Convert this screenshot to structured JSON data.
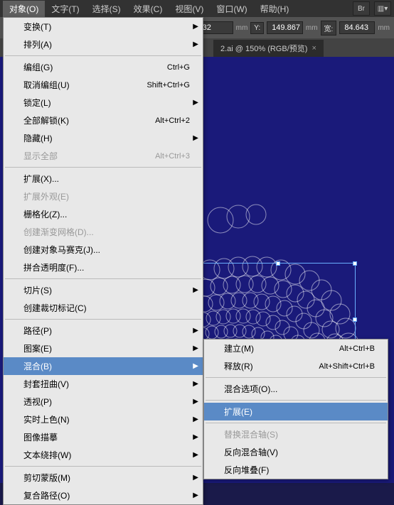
{
  "menubar": {
    "items": [
      "对象(O)",
      "文字(T)",
      "选择(S)",
      "效果(C)",
      "视图(V)",
      "窗口(W)",
      "帮助(H)"
    ],
    "active": 0,
    "right_btn1": "Br",
    "right_btn2": "▥▾"
  },
  "toolbar": {
    "x_val": "32",
    "x_unit": "mm",
    "y_label": "Y:",
    "y_val": "149.867",
    "y_unit": "mm",
    "w_label": "宽:",
    "w_val": "84.643",
    "w_unit": "mm"
  },
  "tabs": {
    "active": {
      "label": "2.ai @ 150% (RGB/预览)",
      "close": "×"
    }
  },
  "menu": [
    {
      "label": "变换(T)",
      "sub": true
    },
    {
      "label": "排列(A)",
      "sub": true
    },
    {
      "sep": true
    },
    {
      "label": "编组(G)",
      "shortcut": "Ctrl+G"
    },
    {
      "label": "取消编组(U)",
      "shortcut": "Shift+Ctrl+G"
    },
    {
      "label": "锁定(L)",
      "sub": true
    },
    {
      "label": "全部解锁(K)",
      "shortcut": "Alt+Ctrl+2"
    },
    {
      "label": "隐藏(H)",
      "sub": true
    },
    {
      "label": "显示全部",
      "shortcut": "Alt+Ctrl+3",
      "disabled": true
    },
    {
      "sep": true
    },
    {
      "label": "扩展(X)..."
    },
    {
      "label": "扩展外观(E)",
      "disabled": true
    },
    {
      "label": "栅格化(Z)..."
    },
    {
      "label": "创建渐变网格(D)...",
      "disabled": true
    },
    {
      "label": "创建对象马赛克(J)..."
    },
    {
      "label": "拼合透明度(F)..."
    },
    {
      "sep": true
    },
    {
      "label": "切片(S)",
      "sub": true
    },
    {
      "label": "创建裁切标记(C)"
    },
    {
      "sep": true
    },
    {
      "label": "路径(P)",
      "sub": true
    },
    {
      "label": "图案(E)",
      "sub": true
    },
    {
      "label": "混合(B)",
      "sub": true,
      "highlight": true
    },
    {
      "label": "封套扭曲(V)",
      "sub": true
    },
    {
      "label": "透视(P)",
      "sub": true
    },
    {
      "label": "实时上色(N)",
      "sub": true
    },
    {
      "label": "图像描摹",
      "sub": true
    },
    {
      "label": "文本绕排(W)",
      "sub": true
    },
    {
      "sep": true
    },
    {
      "label": "剪切蒙版(M)",
      "sub": true
    },
    {
      "label": "复合路径(O)",
      "sub": true
    }
  ],
  "submenu": [
    {
      "label": "建立(M)",
      "shortcut": "Alt+Ctrl+B"
    },
    {
      "label": "释放(R)",
      "shortcut": "Alt+Shift+Ctrl+B"
    },
    {
      "sep": true
    },
    {
      "label": "混合选项(O)..."
    },
    {
      "sep": true
    },
    {
      "label": "扩展(E)",
      "highlight": true
    },
    {
      "sep": true
    },
    {
      "label": "替换混合轴(S)",
      "disabled": true
    },
    {
      "label": "反向混合轴(V)"
    },
    {
      "label": "反向堆叠(F)"
    }
  ]
}
